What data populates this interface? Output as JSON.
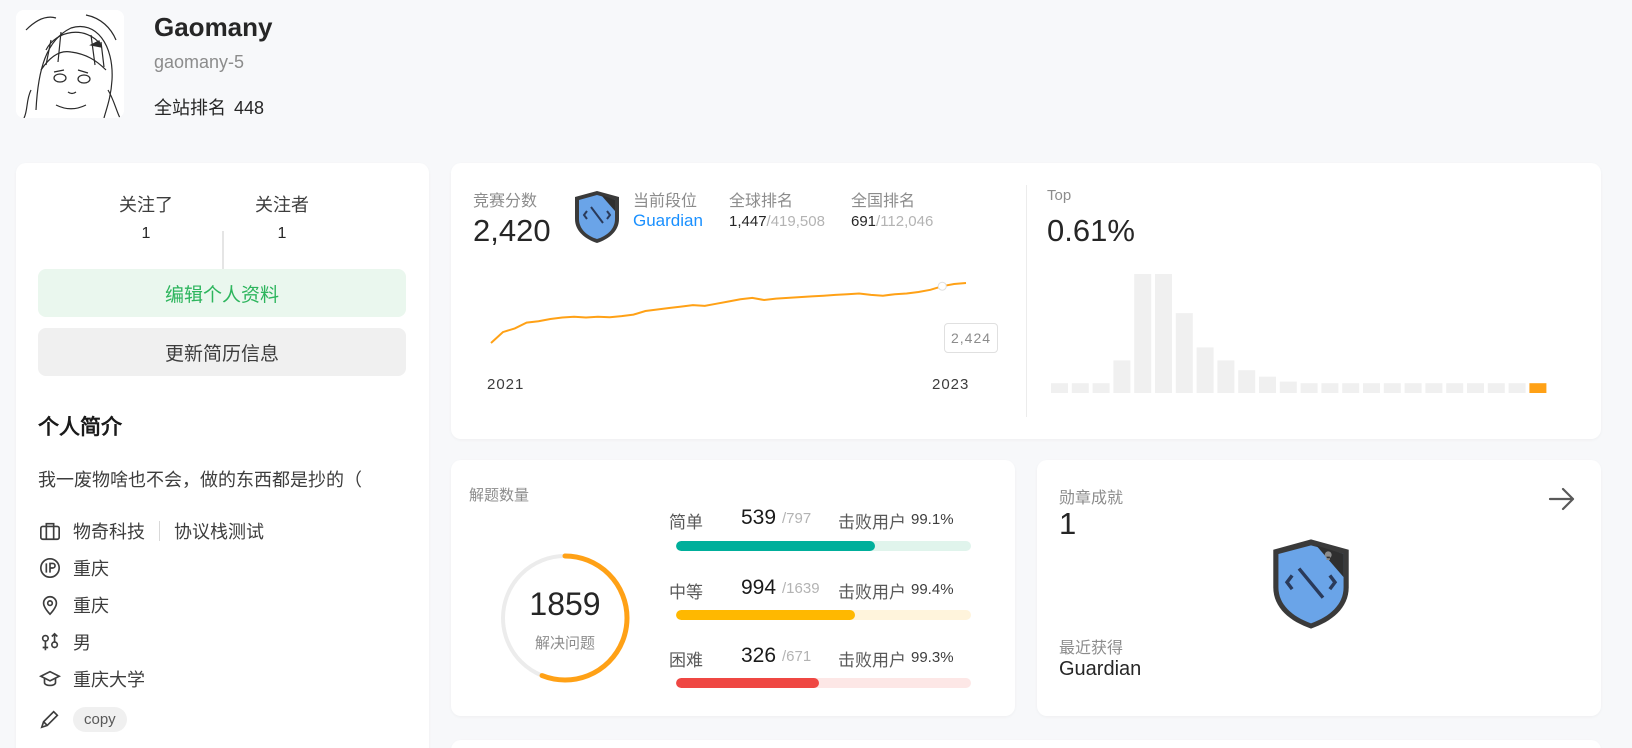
{
  "profile": {
    "display_name": "Gaomany",
    "username": "gaomany-5",
    "rank_label": "全站排名",
    "rank_value": "448"
  },
  "social": {
    "following_label": "关注了",
    "following_count": "1",
    "followers_label": "关注者",
    "followers_count": "1"
  },
  "buttons": {
    "edit_profile": "编辑个人资料",
    "update_resume": "更新简历信息"
  },
  "about": {
    "title": "个人简介",
    "bio": "我一废物啥也不会，做的东西都是抄的（",
    "company": "物奇科技",
    "job": "协议栈测试",
    "ip_location": "重庆",
    "location": "重庆",
    "gender": "男",
    "school": "重庆大学",
    "skill_tag": "copy"
  },
  "contest": {
    "rating_label": "竞赛分数",
    "rating": "2,420",
    "tier_label": "当前段位",
    "tier": "Guardian",
    "global_rank_label": "全球排名",
    "global_rank": "1,447",
    "global_total": "/419,508",
    "national_rank_label": "全国排名",
    "national_rank": "691",
    "national_total": "/112,046",
    "top_label": "Top",
    "top_percent": "0.61%",
    "year_start": "2021",
    "year_end": "2023",
    "tooltip_value": "2,424",
    "line_color": "#ffa116",
    "hist_highlight_color": "#ffa116"
  },
  "chart_data": [
    {
      "type": "line",
      "title": "",
      "x": [
        0,
        1,
        2,
        3,
        4,
        5,
        6,
        7,
        8,
        9,
        10,
        11,
        12,
        13,
        14,
        15,
        16,
        17,
        18,
        19,
        20,
        21,
        22,
        23,
        24,
        25,
        26,
        27,
        28,
        29,
        30,
        31,
        32,
        33,
        34,
        35,
        36,
        37,
        38,
        39,
        40
      ],
      "series": [
        {
          "values": [
            1600,
            1750,
            1800,
            1880,
            1900,
            1930,
            1950,
            1960,
            1950,
            1960,
            1955,
            1970,
            1990,
            2040,
            2060,
            2080,
            2100,
            2120,
            2110,
            2140,
            2170,
            2200,
            2220,
            2190,
            2210,
            2220,
            2230,
            2240,
            2250,
            2260,
            2270,
            2280,
            2260,
            2250,
            2270,
            2280,
            2300,
            2330,
            2380,
            2410,
            2424
          ]
        }
      ],
      "xticks": [
        "2021",
        "2023"
      ],
      "annotation": "2,424"
    },
    {
      "type": "bar",
      "title": "Top 0.61%",
      "values": [
        6,
        6,
        6,
        20,
        73,
        73,
        49,
        28,
        20,
        14,
        10,
        7,
        6,
        6,
        6,
        6,
        6,
        6,
        6,
        6,
        6,
        6,
        6,
        6
      ],
      "highlight_index": 23
    }
  ],
  "problems": {
    "title": "解题数量",
    "solved": "1859",
    "solved_label": "解决问题",
    "beat_label": "击败用户",
    "ring_fraction": 0.56,
    "difficulties": [
      {
        "label": "简单",
        "solved": "539",
        "total": "/797",
        "beat": "99.1%",
        "fraction": 0.676,
        "color": "#00af9b",
        "track": "#e0f4ec"
      },
      {
        "label": "中等",
        "solved": "994",
        "total": "/1639",
        "beat": "99.4%",
        "fraction": 0.606,
        "color": "#ffb800",
        "track": "#fff4dc"
      },
      {
        "label": "困难",
        "solved": "326",
        "total": "/671",
        "beat": "99.3%",
        "fraction": 0.486,
        "color": "#ef4743",
        "track": "#fde7e6"
      }
    ]
  },
  "badges": {
    "title": "勋章成就",
    "count": "1",
    "recent_label": "最近获得",
    "recent_name": "Guardian"
  }
}
